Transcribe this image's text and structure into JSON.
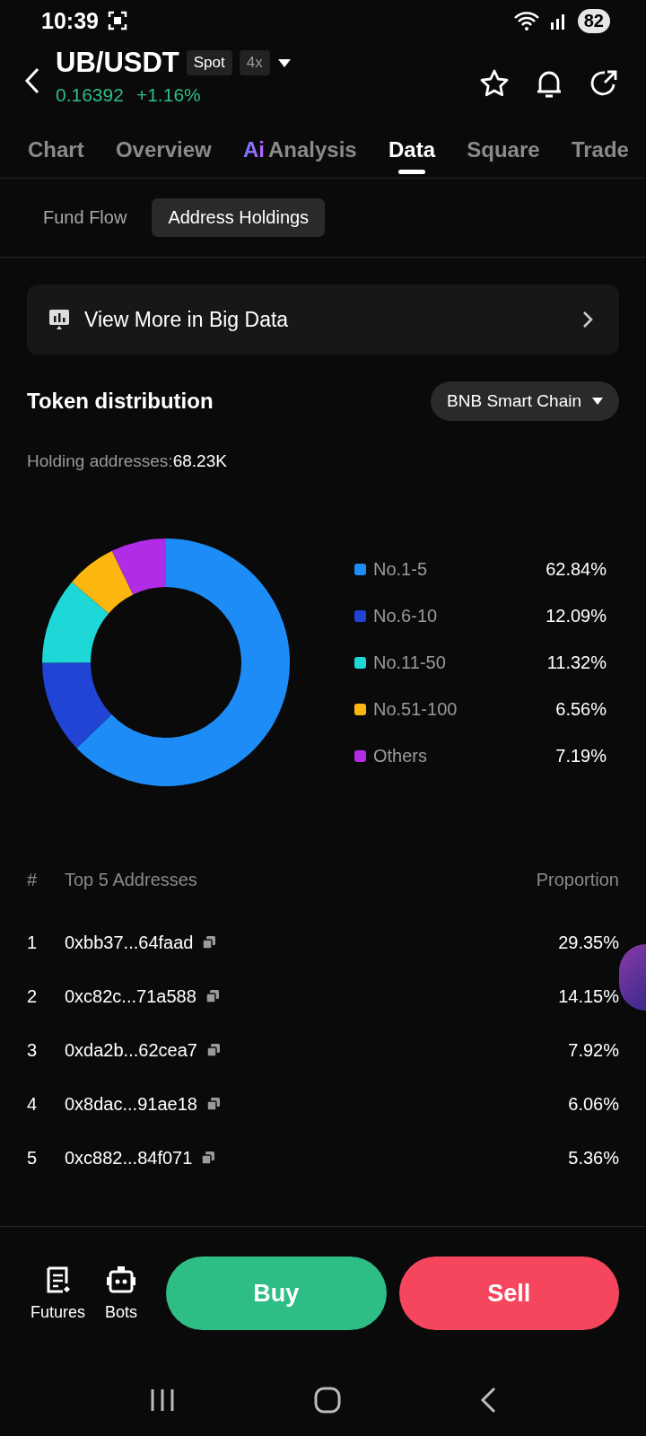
{
  "status_bar": {
    "time": "10:39",
    "battery": "82"
  },
  "header": {
    "pair": "UB/USDT",
    "market_badge": "Spot",
    "leverage_badge": "4x",
    "price": "0.16392",
    "change": "+1.16%"
  },
  "tabs": [
    {
      "label": "Chart",
      "selected": false
    },
    {
      "label": "Overview",
      "selected": false
    },
    {
      "label": "Analysis",
      "badge": "Ai",
      "selected": false
    },
    {
      "label": "Data",
      "selected": true
    },
    {
      "label": "Square",
      "selected": false
    },
    {
      "label": "Trade",
      "selected": false
    }
  ],
  "sub_tabs": [
    {
      "label": "Fund Flow",
      "selected": false
    },
    {
      "label": "Address Holdings",
      "selected": true
    }
  ],
  "big_data_link": "View More in Big Data",
  "distribution": {
    "title": "Token distribution",
    "chain": "BNB Smart Chain",
    "holders_label": "Holding addresses:",
    "holders_value": "68.23K",
    "legend": [
      {
        "value": "62.84%",
        "color": "#1e8cf7"
      },
      {
        "value": "12.09%",
        "color": "#2144d4"
      },
      {
        "value": "11.32%",
        "color": "#1ed8d8"
      },
      {
        "value": "6.56%",
        "color": "#fbb710"
      },
      {
        "value": "7.19%",
        "color": "#b12ce6"
      }
    ],
    "chart_data": {
      "type": "donut",
      "categories": [
        "No.1-5",
        "No.6-10",
        "No.11-50",
        "No.51-100",
        "Others"
      ],
      "values": [
        62.84,
        12.09,
        11.32,
        6.56,
        7.19
      ]
    }
  },
  "table": {
    "columns": [
      "#",
      "Top 5 Addresses",
      "Proportion"
    ],
    "rows": [
      {
        "rank": "1",
        "address": "0xbb37...64faad",
        "proportion": "29.35%"
      },
      {
        "rank": "2",
        "address": "0xc82c...71a588",
        "proportion": "14.15%"
      },
      {
        "rank": "3",
        "address": "0xda2b...62cea7",
        "proportion": "7.92%"
      },
      {
        "rank": "4",
        "address": "0x8dac...91ae18",
        "proportion": "6.06%"
      },
      {
        "rank": "5",
        "address": "0xc882...84f071",
        "proportion": "5.36%"
      }
    ]
  },
  "bottom_bar": {
    "shortcuts": [
      {
        "label": "Futures",
        "kind": "futures"
      },
      {
        "label": "Bots",
        "kind": "bots"
      }
    ],
    "buy": "Buy",
    "sell": "Sell"
  }
}
